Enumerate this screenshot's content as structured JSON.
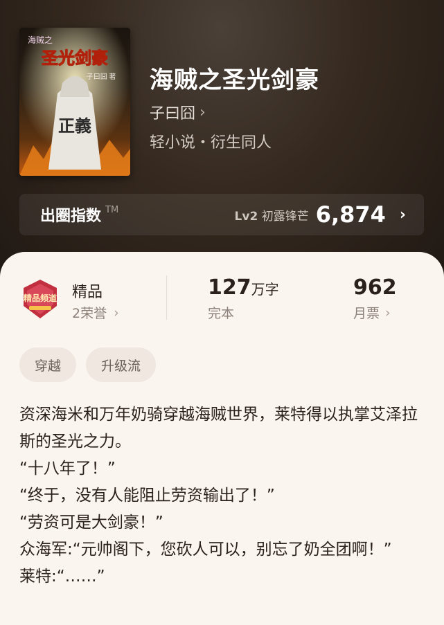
{
  "book": {
    "title": "海贼之圣光剑豪",
    "author": "子曰囧",
    "genre": "轻小说・衍生同人",
    "cover": {
      "top_text": "海贼之",
      "title_text": "圣光剑豪",
      "author_text": "子曰囧 著",
      "back_text": "正義"
    }
  },
  "circle_index": {
    "label": "出圈指数",
    "tm": "TM",
    "level_code": "Lv2",
    "level_name": "初露锋芒",
    "score": "6,874"
  },
  "stats": {
    "quality": {
      "title": "精品",
      "honors": "2荣誉",
      "badge_text": "精品频道"
    },
    "words": {
      "value": "127",
      "unit": "万字",
      "status": "完本"
    },
    "tickets": {
      "value": "962",
      "label": "月票"
    }
  },
  "tags": [
    "穿越",
    "升级流"
  ],
  "description": [
    "资深海米和万年奶骑穿越海贼世界，莱特得以执掌艾泽拉斯的圣光之力。",
    "“十八年了！”",
    "“终于，没有人能阻止劳资输出了！”",
    "“劳资可是大剑豪！”",
    "众海军:“元帅阁下，您砍人可以，别忘了奶全团啊！”",
    "莱特:“……”"
  ],
  "icons": {
    "author_chevron": "chevron-right-icon",
    "circle_chevron": "chevron-right-icon",
    "honors_chevron": "chevron-right-icon",
    "tickets_chevron": "chevron-right-icon"
  },
  "colors": {
    "hero_bg": "#35291f",
    "sheet_bg": "#fbf5ef",
    "badge_main": "#c2303f"
  }
}
